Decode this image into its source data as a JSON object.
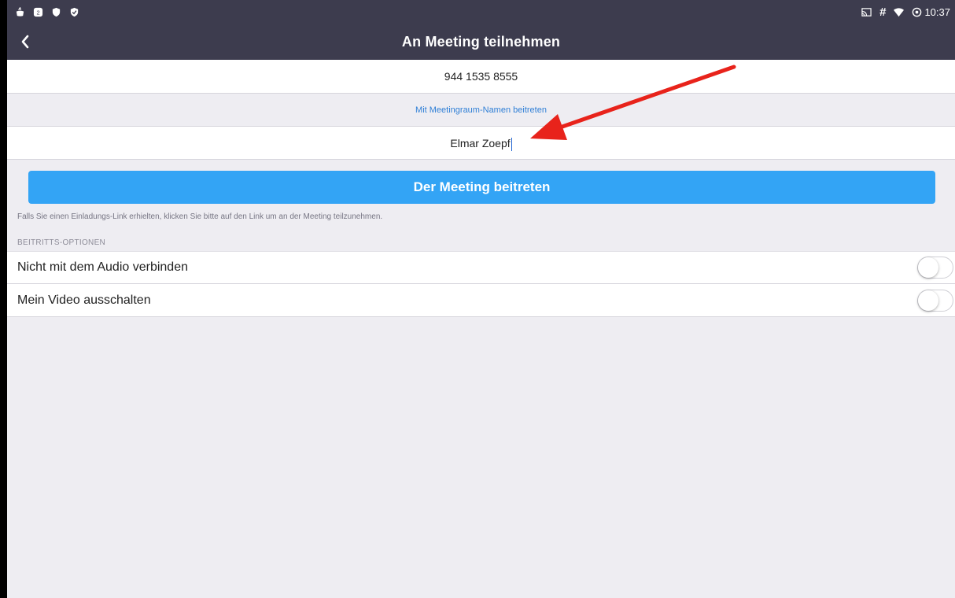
{
  "status_bar": {
    "left_icons": [
      "app-notification-icon",
      "shield-badge-icon",
      "shield-icon",
      "shield-check-icon"
    ],
    "right_icons": [
      "cast-icon",
      "hash-icon",
      "wifi-icon",
      "data-saver-icon"
    ],
    "time": "10:37"
  },
  "header": {
    "back_icon": "chevron-left-icon",
    "title": "An Meeting teilnehmen"
  },
  "form": {
    "meeting_id_value": "944 1535 8555",
    "room_name_link": "Mit Meetingraum-Namen beitreten",
    "name_value": "Elmar Zoepf"
  },
  "join_button": {
    "label": "Der Meeting beitreten"
  },
  "hint_text": "Falls Sie einen Einladungs-Link erhielten, klicken Sie bitte auf den Link um an der Meeting teilzunehmen.",
  "options": {
    "header": "BEITRITTS-OPTIONEN",
    "items": [
      {
        "label": "Nicht mit dem Audio verbinden",
        "enabled": false
      },
      {
        "label": "Mein Video ausschalten",
        "enabled": false
      }
    ]
  },
  "colors": {
    "header_bg": "#3d3c4e",
    "join_button": "#33a4f5",
    "link": "#2f7fd6",
    "annotation_arrow": "#e8231b"
  }
}
